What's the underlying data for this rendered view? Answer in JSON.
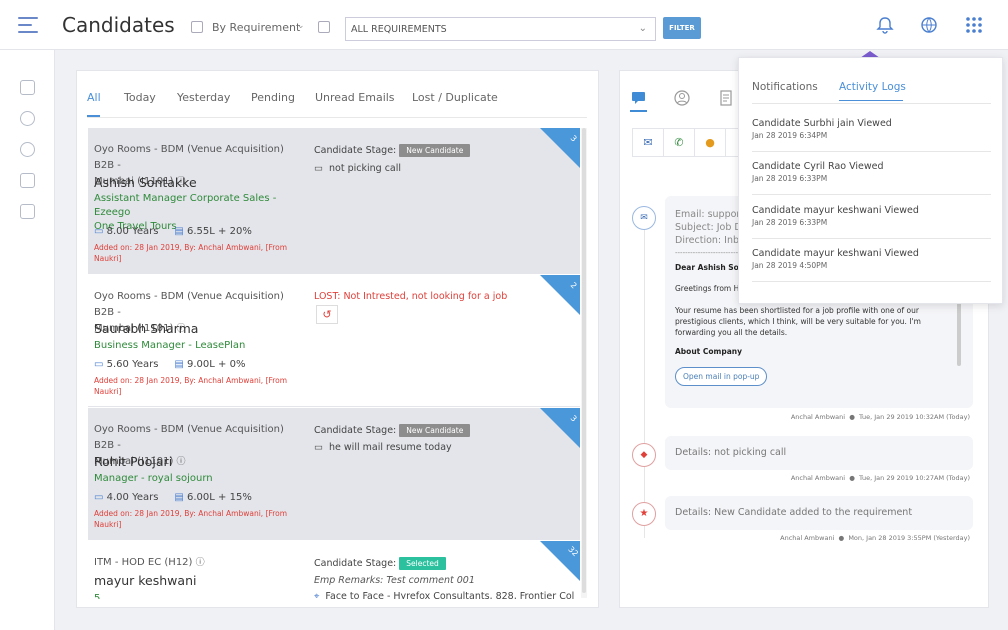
{
  "header": {
    "title": "Candidates",
    "by_requirement": "By Requirement",
    "requirement_select": "ALL REQUIREMENTS",
    "filter_label": "FILTER"
  },
  "tabs": [
    "All",
    "Today",
    "Yesterday",
    "Pending",
    "Unread Emails",
    "Lost / Duplicate"
  ],
  "candidates": [
    {
      "req1": "Oyo Rooms - BDM (Venue Acquisition) B2B -",
      "req2": "Mumbai (I1101)",
      "name": "Ashish Sontakke",
      "job1": "Assistant Manager Corporate Sales - Ezeego",
      "job2": "One Travel Tours",
      "exp": "8.00 Years",
      "ctc": "6.55L + 20%",
      "added1": "Added on: 28 Jan 2019, By: Anchal Ambwani, [From",
      "added2": "Naukri]",
      "stage_label": "Candidate Stage:",
      "badge": "New Candidate",
      "note": "not picking call",
      "corner": "3"
    },
    {
      "req1": "Oyo Rooms - BDM (Venue Acquisition) B2B -",
      "req2": "Mumbai (I1101)",
      "name": "Saurabh Sharma",
      "job1": "Business Manager - LeasePlan",
      "exp": "5.60 Years",
      "ctc": "9.00L + 0%",
      "added1": "Added on: 28 Jan 2019, By: Anchal Ambwani, [From",
      "added2": "Naukri]",
      "lost": "LOST: Not Intrested, not looking for a job",
      "corner": "2"
    },
    {
      "req1": "Oyo Rooms - BDM (Venue Acquisition) B2B -",
      "req2": "Mumbai (I1101)",
      "name": "Rohit Poojari",
      "job1": "Manager - royal sojourn",
      "exp": "4.00 Years",
      "ctc": "6.00L + 15%",
      "added1": "Added on: 28 Jan 2019, By: Anchal Ambwani, [From",
      "added2": "Naukri]",
      "stage_label": "Candidate Stage:",
      "badge": "New Candidate",
      "note": "he will mail resume today",
      "corner": "3"
    },
    {
      "req1": "ITM - HOD EC (H12)",
      "name": "mayur keshwani",
      "job1": "5",
      "stage_label": "Candidate Stage:",
      "badge": "Selected",
      "remarks": "Emp Remarks: Test comment 001",
      "location": "Face to Face - Hyrefox Consultants, 828, Frontier Col",
      "corner": "32"
    }
  ],
  "email": {
    "h1": "Email: suppor",
    "h2": "Subject: Job D",
    "h3": "Direction: Inb",
    "dashes": "----------------------------",
    "dear": "Dear Ashish Son",
    "greet": "Greetings from H",
    "body": "Your resume has been shortlisted for a job profile with one of our prestigious clients, which I think, will be very suitable for you. I'm forwarding you all the details.",
    "about": "About Company",
    "popup_btn": "Open mail in pop-up",
    "foot_name": "Anchal Ambwani",
    "foot_time": "Tue, Jan 29 2019 10:32AM (Today)"
  },
  "timeline": [
    {
      "text": "Details: not picking call",
      "name": "Anchal Ambwani",
      "time": "Tue, Jan 29 2019 10:27AM (Today)"
    },
    {
      "text": "Details: New Candidate added to the requirement",
      "name": "Anchal Ambwani",
      "time": "Mon, Jan 28 2019 3:55PM (Yesterday)"
    }
  ],
  "dropdown": {
    "tab_notifications": "Notifications",
    "tab_activity": "Activity Logs",
    "items": [
      {
        "title": "Candidate Surbhi jain Viewed",
        "date": "Jan 28 2019 6:34PM"
      },
      {
        "title": "Candidate Cyril Rao Viewed",
        "date": "Jan 28 2019 6:33PM"
      },
      {
        "title": "Candidate mayur keshwani Viewed",
        "date": "Jan 28 2019 6:33PM"
      },
      {
        "title": "Candidate mayur keshwani Viewed",
        "date": "Jan 28 2019 4:50PM"
      }
    ]
  },
  "colors": {
    "accent": "#4a8fd8",
    "green": "#2f8a3a",
    "red": "#e0403a",
    "badge_grey": "#8d8d8d",
    "badge_green": "#2bc19e"
  }
}
